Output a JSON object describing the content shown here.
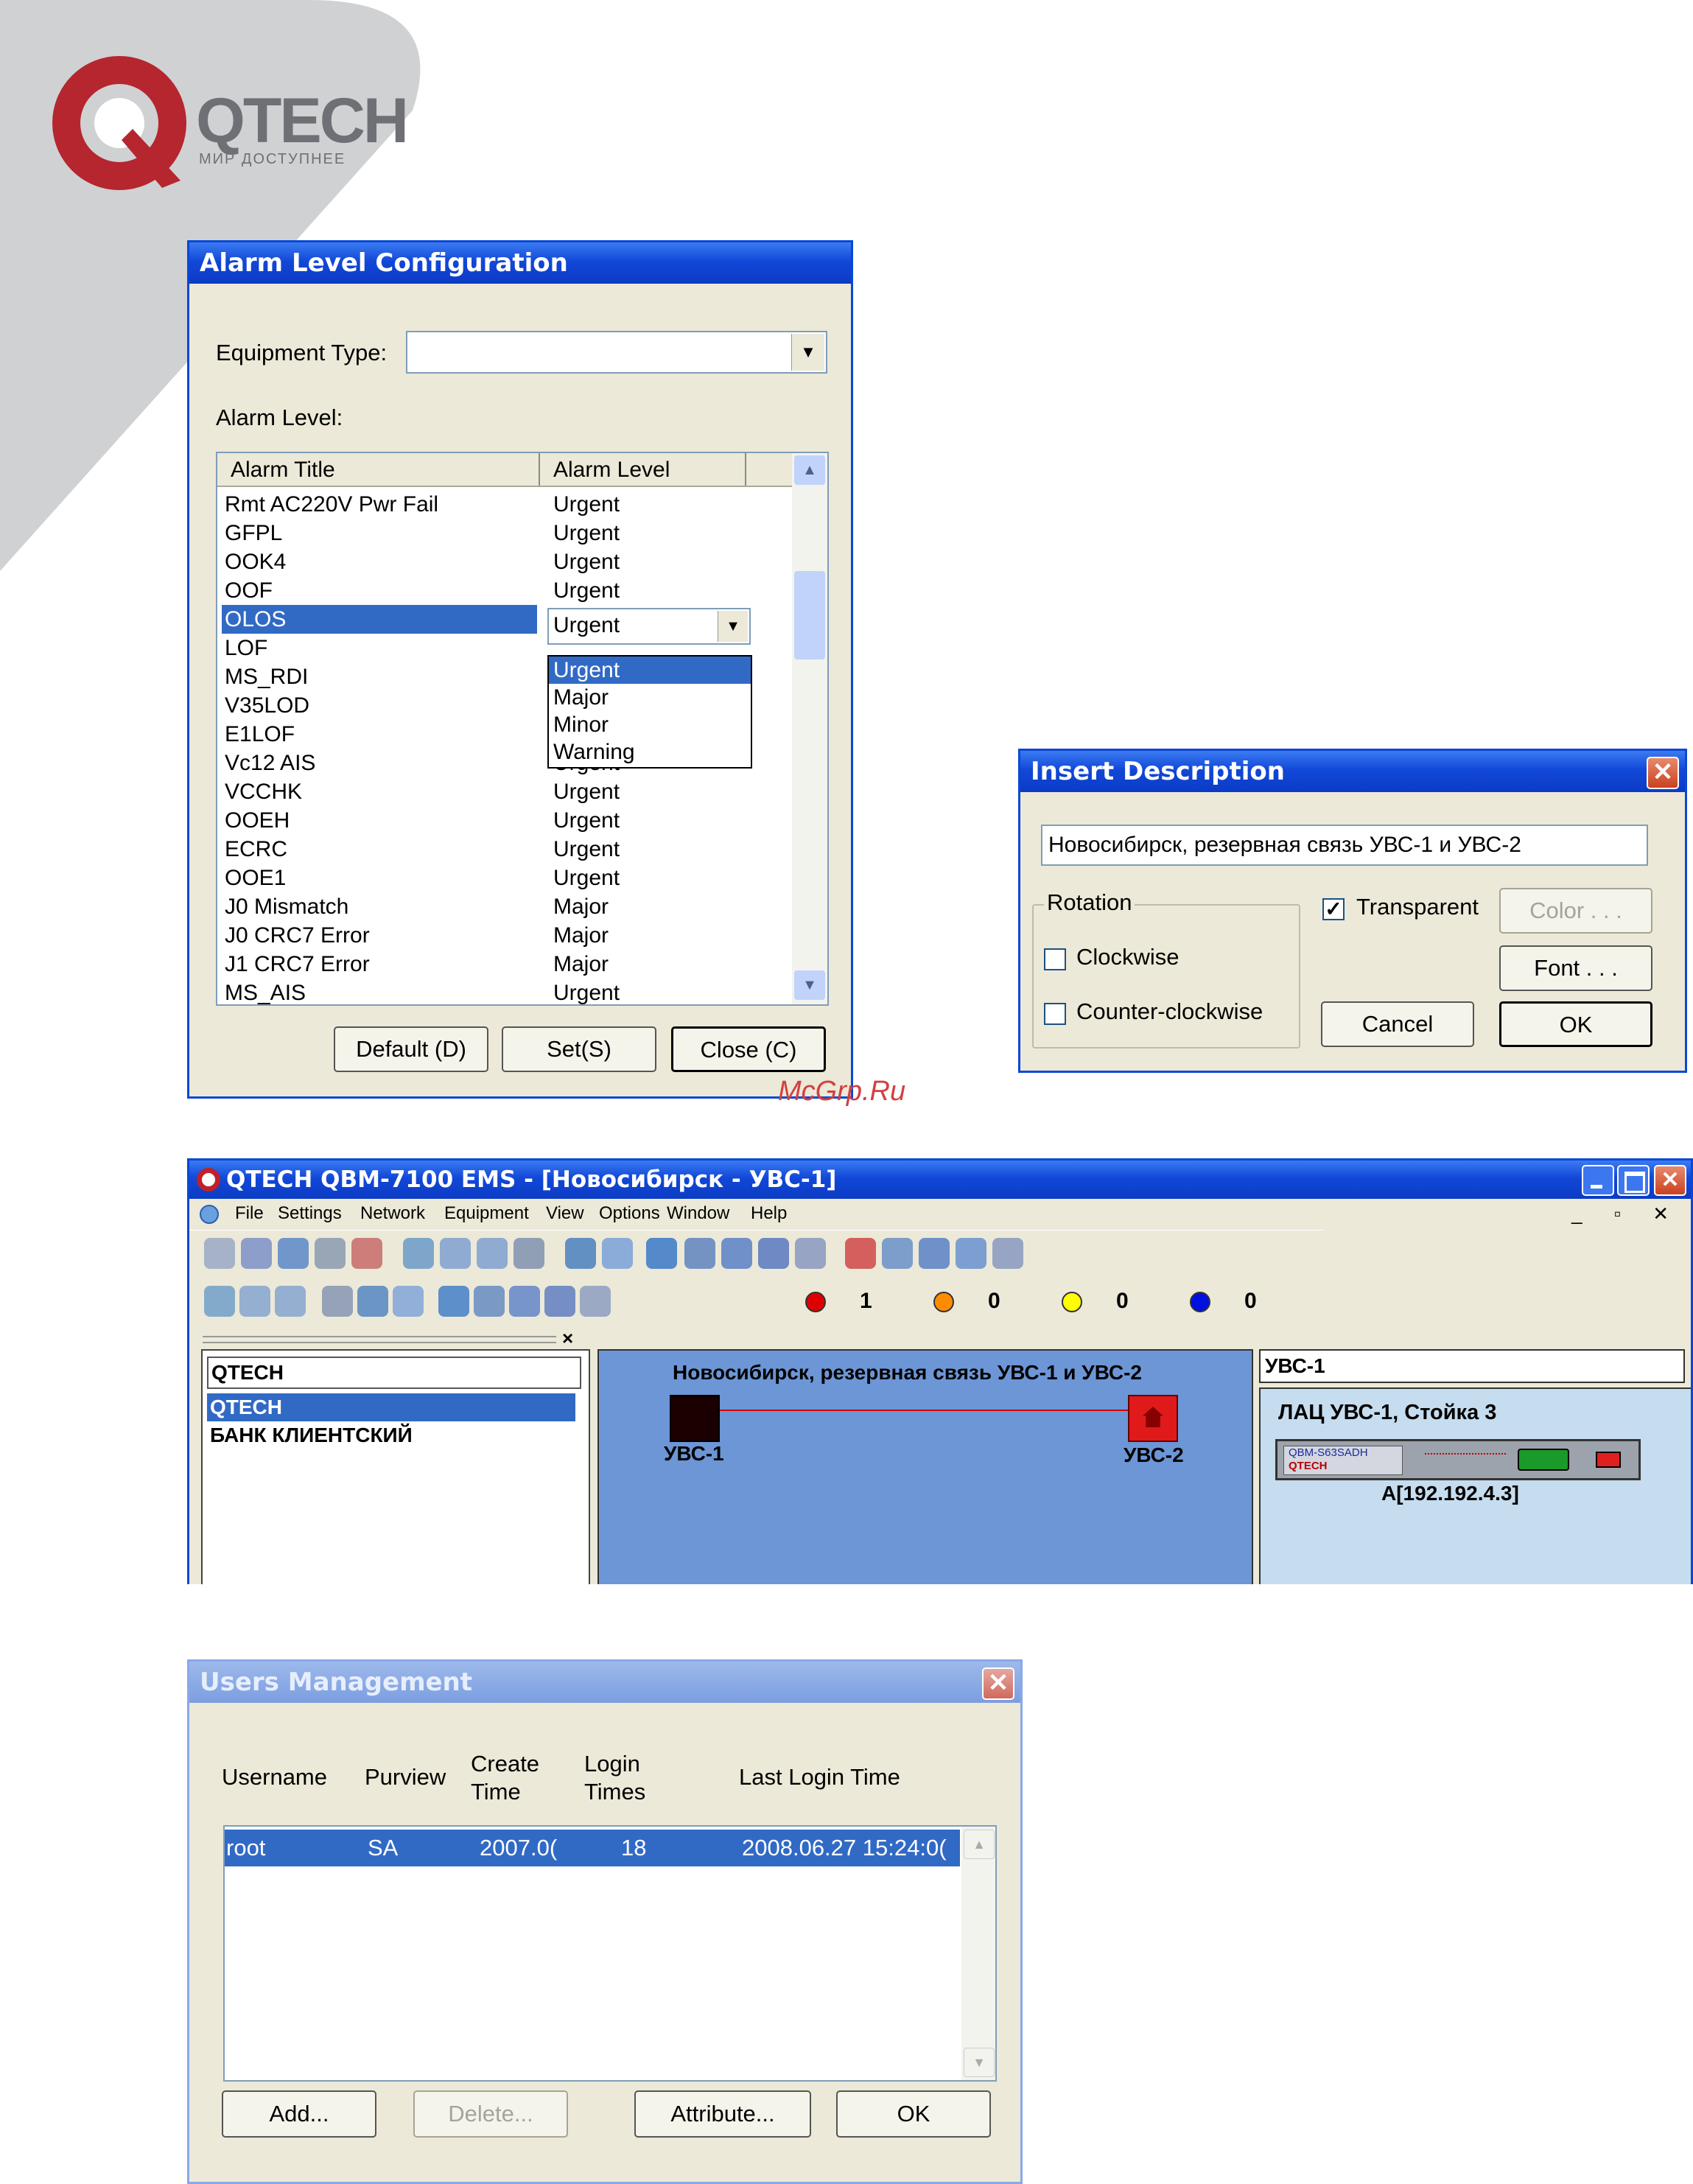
{
  "brand": {
    "name": "QTECH",
    "slogan": "МИР ДОСТУПНЕЕ"
  },
  "watermark": "McGrp.Ru",
  "alarm_dialog": {
    "title": "Alarm Level Configuration",
    "equipment_type_label": "Equipment Type:",
    "equipment_type_value": "",
    "alarm_level_label": "Alarm Level:",
    "columns": {
      "title": "Alarm Title",
      "level": "Alarm Level"
    },
    "rows": [
      {
        "title": "Rmt AC220V Pwr Fail",
        "level": "Urgent"
      },
      {
        "title": "GFPL",
        "level": "Urgent"
      },
      {
        "title": "OOK4",
        "level": "Urgent"
      },
      {
        "title": "OOF",
        "level": "Urgent"
      },
      {
        "title": "OLOS",
        "level": "Urgent"
      },
      {
        "title": "LOF",
        "level": ""
      },
      {
        "title": "MS_RDI",
        "level": ""
      },
      {
        "title": "V35LOD",
        "level": ""
      },
      {
        "title": "E1LOF",
        "level": ""
      },
      {
        "title": "Vc12 AIS",
        "level": "Urgent"
      },
      {
        "title": "VCCHK",
        "level": "Urgent"
      },
      {
        "title": "OOEH",
        "level": "Urgent"
      },
      {
        "title": "ECRC",
        "level": "Urgent"
      },
      {
        "title": "OOE1",
        "level": "Urgent"
      },
      {
        "title": "J0 Mismatch",
        "level": "Major"
      },
      {
        "title": "J0 CRC7 Error",
        "level": "Major"
      },
      {
        "title": "J1 CRC7 Error",
        "level": "Major"
      },
      {
        "title": "MS_AIS",
        "level": "Urgent"
      }
    ],
    "selected_row": 4,
    "dropdown_value": "Urgent",
    "dropdown_options": [
      "Urgent",
      "Major",
      "Minor",
      "Warning"
    ],
    "buttons": {
      "default": "Default (D)",
      "set": "Set(S)",
      "close": "Close (C)"
    }
  },
  "insert_dialog": {
    "title": "Insert Description",
    "text_value": "Новосибирск, резервная связь УВС-1 и УВС-2",
    "rotation_label": "Rotation",
    "clockwise_label": "Clockwise",
    "counter_label": "Counter-clockwise",
    "transparent_label": "Transparent",
    "transparent_checked": "✓",
    "buttons": {
      "color": "Color . . .",
      "font": "Font . . .",
      "cancel": "Cancel",
      "ok": "OK"
    }
  },
  "ems": {
    "title": "QTECH QBM-7100 EMS - [Новосибирск - УВС-1]",
    "menu": [
      "File",
      "Settings",
      "Network",
      "Equipment",
      "View",
      "Options",
      "Window",
      "Help"
    ],
    "alarm_counts": [
      {
        "color": "#e00000",
        "count": "1"
      },
      {
        "color": "#ff8c00",
        "count": "0"
      },
      {
        "color": "#ffff00",
        "count": "0"
      },
      {
        "color": "#0010e0",
        "count": "0"
      }
    ],
    "tree": {
      "root": "QTECH",
      "items": [
        "QTECH",
        "БАНК КЛИЕНТСКИЙ"
      ]
    },
    "canvas": {
      "caption": "Новосибирск, резервная связь УВС-1 и УВС-2",
      "node1": "УВС-1",
      "node2": "УВС-2"
    },
    "right_panel": {
      "header": "УВС-1",
      "rack": "ЛАЦ УВС-1, Стойка 3",
      "device_model": "QBM-S63SADH",
      "device_brand": "QTECH",
      "ip": "A[192.192.4.3]"
    }
  },
  "users_dialog": {
    "title": "Users Management",
    "columns": [
      "Username",
      "Purview",
      "Create Time",
      "Login Times",
      "Last Login Time"
    ],
    "rows": [
      {
        "username": "root",
        "purview": "SA",
        "create": "2007.0(",
        "logins": "18",
        "last": "2008.06.27  15:24:0("
      }
    ],
    "buttons": {
      "add": "Add...",
      "delete": "Delete...",
      "attribute": "Attribute...",
      "ok": "OK"
    }
  }
}
